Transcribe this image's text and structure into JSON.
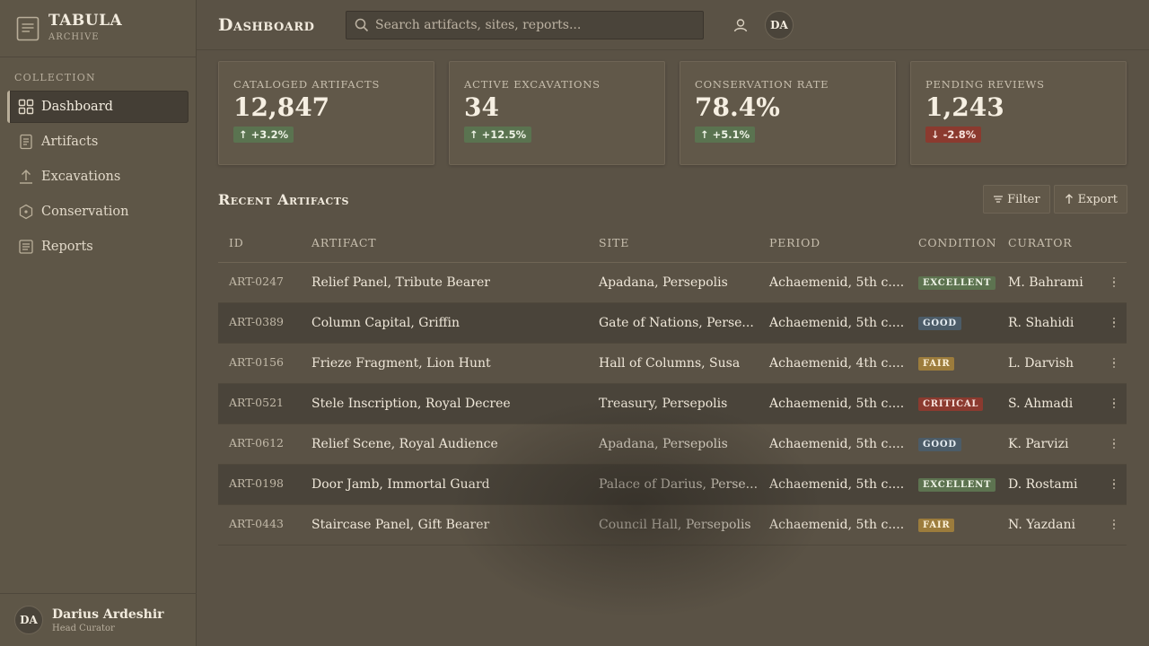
{
  "brand": {
    "title": "TABULA",
    "subtitle": "ARCHIVE",
    "icon": "document-icon"
  },
  "sidebar": {
    "section_label": "COLLECTION",
    "items": [
      {
        "label": "Dashboard",
        "icon": "grid-icon",
        "active": true
      },
      {
        "label": "Artifacts",
        "icon": "document-icon"
      },
      {
        "label": "Excavations",
        "icon": "upload-arrow-icon"
      },
      {
        "label": "Conservation",
        "icon": "hexagon-icon"
      },
      {
        "label": "Reports",
        "icon": "report-icon"
      }
    ],
    "user": {
      "initials": "DA",
      "name": "Darius Ardeshir",
      "role": "Head Curator"
    }
  },
  "header": {
    "title": "Dashboard",
    "search_placeholder": "Search artifacts, sites, reports...",
    "avatar_initials": "DA"
  },
  "kpis": [
    {
      "label": "Cataloged Artifacts",
      "value": "12,847",
      "delta": "+3.2%",
      "direction": "up"
    },
    {
      "label": "Active Excavations",
      "value": "34",
      "delta": "+12.5%",
      "direction": "up"
    },
    {
      "label": "Conservation Rate",
      "value": "78.4%",
      "delta": "+5.1%",
      "direction": "up"
    },
    {
      "label": "Pending Reviews",
      "value": "1,243",
      "delta": "-2.8%",
      "direction": "down"
    }
  ],
  "recent": {
    "title": "Recent Artifacts",
    "filter_label": "Filter",
    "export_label": "Export",
    "columns": [
      "ID",
      "Artifact",
      "Site",
      "Period",
      "Condition",
      "Curator"
    ],
    "rows": [
      {
        "id": "ART-0247",
        "artifact": "Relief Panel, Tribute Bearer",
        "site": "Apadana, Persepolis",
        "period": "Achaemenid, 5th c....",
        "condition": "Excellent",
        "curator": "M. Bahrami"
      },
      {
        "id": "ART-0389",
        "artifact": "Column Capital, Griffin",
        "site": "Gate of Nations, Perse...",
        "period": "Achaemenid, 5th c....",
        "condition": "Good",
        "curator": "R. Shahidi"
      },
      {
        "id": "ART-0156",
        "artifact": "Frieze Fragment, Lion Hunt",
        "site": "Hall of Columns, Susa",
        "period": "Achaemenid, 4th c....",
        "condition": "Fair",
        "curator": "L. Darvish"
      },
      {
        "id": "ART-0521",
        "artifact": "Stele Inscription, Royal Decree",
        "site": "Treasury, Persepolis",
        "period": "Achaemenid, 5th c....",
        "condition": "Critical",
        "curator": "S. Ahmadi"
      },
      {
        "id": "ART-0612",
        "artifact": "Relief Scene, Royal Audience",
        "site": "Apadana, Persepolis",
        "period": "Achaemenid, 5th c....",
        "condition": "Good",
        "curator": "K. Parvizi"
      },
      {
        "id": "ART-0198",
        "artifact": "Door Jamb, Immortal Guard",
        "site": "Palace of Darius, Perse...",
        "period": "Achaemenid, 5th c....",
        "condition": "Excellent",
        "curator": "D. Rostami"
      },
      {
        "id": "ART-0443",
        "artifact": "Staircase Panel, Gift Bearer",
        "site": "Council Hall, Persepolis",
        "period": "Achaemenid, 5th c....",
        "condition": "Fair",
        "curator": "N. Yazdani"
      }
    ]
  },
  "colors": {
    "background": "#5a5245",
    "positive": "#5a7350",
    "negative": "#8b3a2f",
    "good": "#4c5c68",
    "fair": "#9c7c3c"
  }
}
